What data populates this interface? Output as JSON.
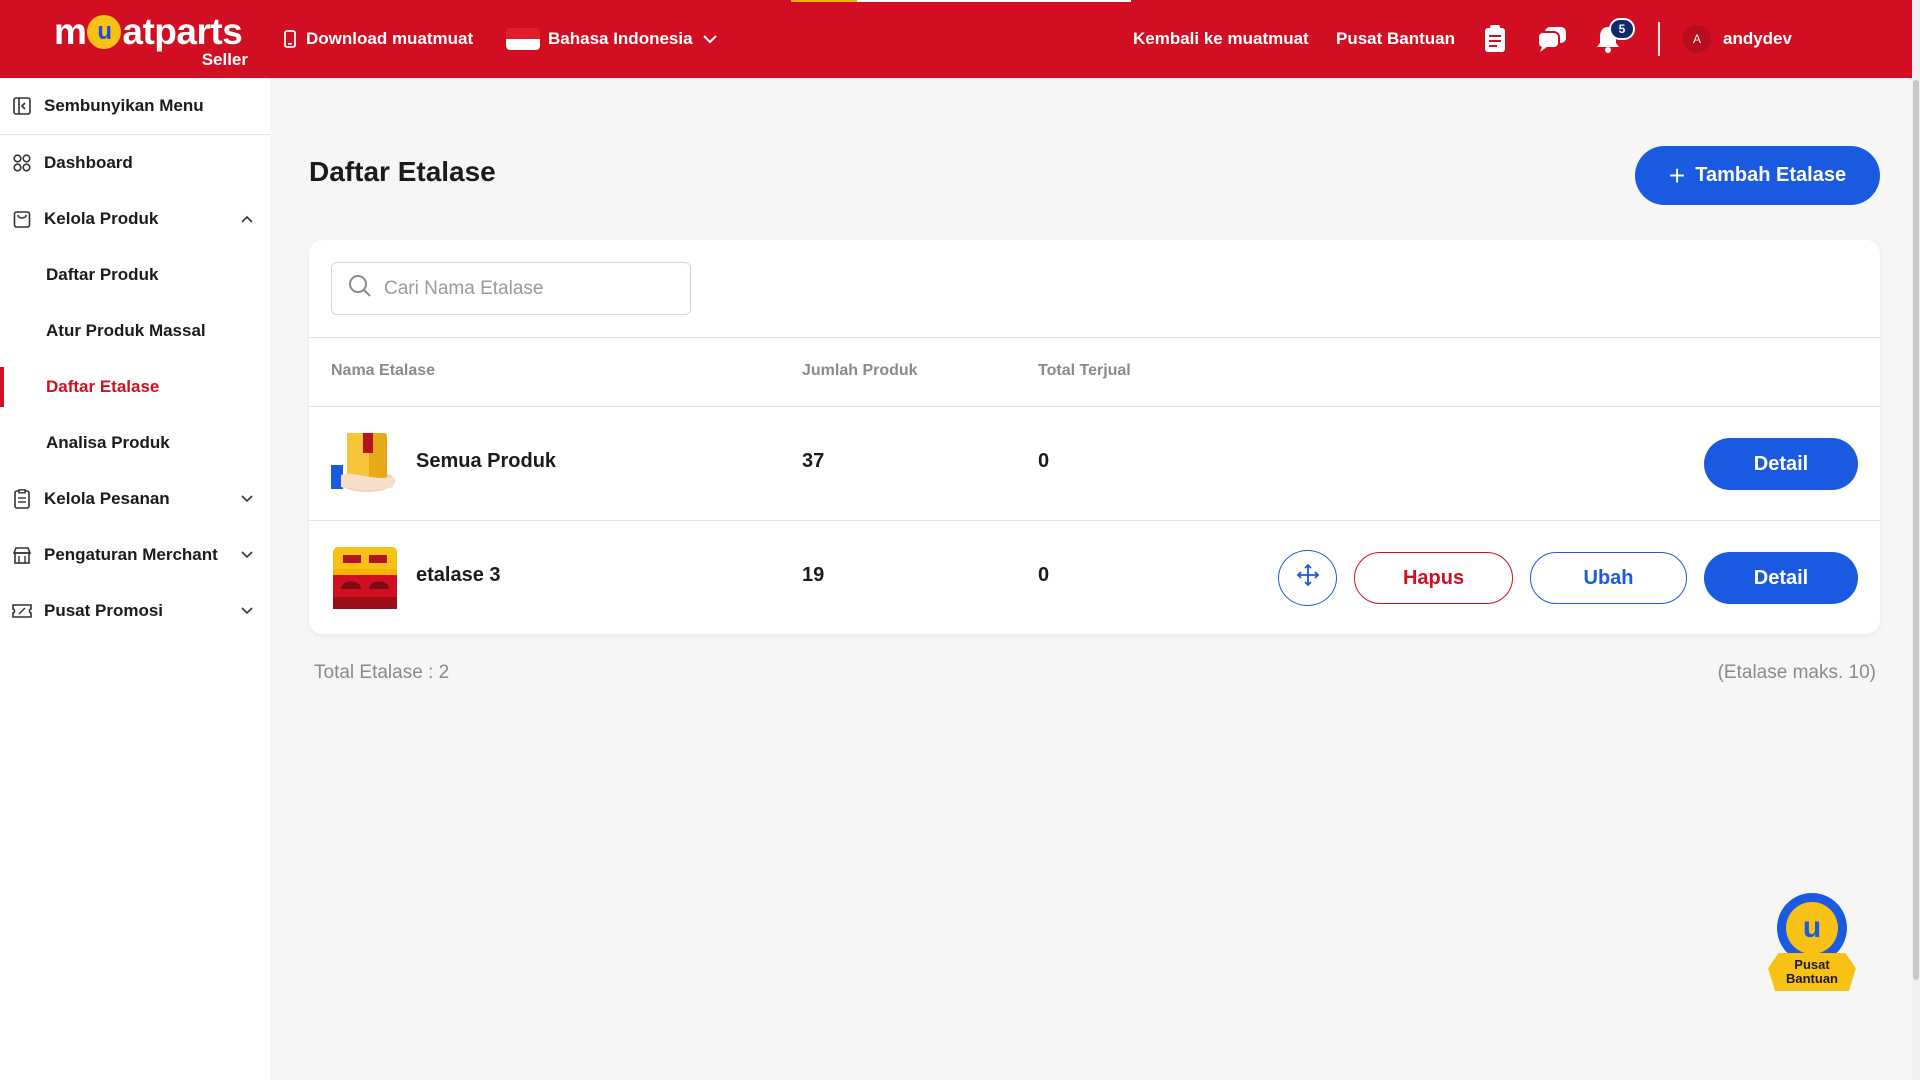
{
  "header": {
    "logo_word": "muatparts",
    "logo_seller": "Seller",
    "download_label": "Download muatmuat",
    "language_label": "Bahasa Indonesia",
    "back_label": "Kembali ke muatmuat",
    "help_label": "Pusat Bantuan",
    "notification_count": "5",
    "avatar_initial": "A",
    "username": "andydev",
    "colors": {
      "brand_red": "#d20f22",
      "accent_blue": "#1a5ae0",
      "accent_yellow": "#f7c115"
    }
  },
  "sidebar": {
    "hide_menu": "Sembunyikan Menu",
    "items": [
      {
        "label": "Dashboard",
        "icon": "grid-icon"
      },
      {
        "label": "Kelola Produk",
        "icon": "bag-icon",
        "expanded": true
      },
      {
        "label": "Daftar Produk"
      },
      {
        "label": "Atur Produk Massal"
      },
      {
        "label": "Daftar Etalase",
        "active": true
      },
      {
        "label": "Analisa Produk"
      },
      {
        "label": "Kelola Pesanan",
        "icon": "clipboard-icon"
      },
      {
        "label": "Pengaturan Merchant",
        "icon": "store-icon"
      },
      {
        "label": "Pusat Promosi",
        "icon": "coupon-icon"
      }
    ]
  },
  "main": {
    "title": "Daftar Etalase",
    "add_button": "Tambah Etalase",
    "search_placeholder": "Cari Nama Etalase",
    "columns": [
      "Nama Etalase",
      "Jumlah Produk",
      "Total Terjual"
    ],
    "rows": [
      {
        "name": "Semua Produk",
        "count": "37",
        "sold": "0",
        "actions": [
          "Detail"
        ]
      },
      {
        "name": "etalase 3",
        "count": "19",
        "sold": "0",
        "actions": [
          "Hapus",
          "Ubah",
          "Detail"
        ]
      }
    ],
    "total_label": "Total Etalase : 2",
    "max_label": "(Etalase maks. 10)"
  },
  "help_widget": {
    "line1": "Pusat",
    "line2": "Bantuan"
  }
}
